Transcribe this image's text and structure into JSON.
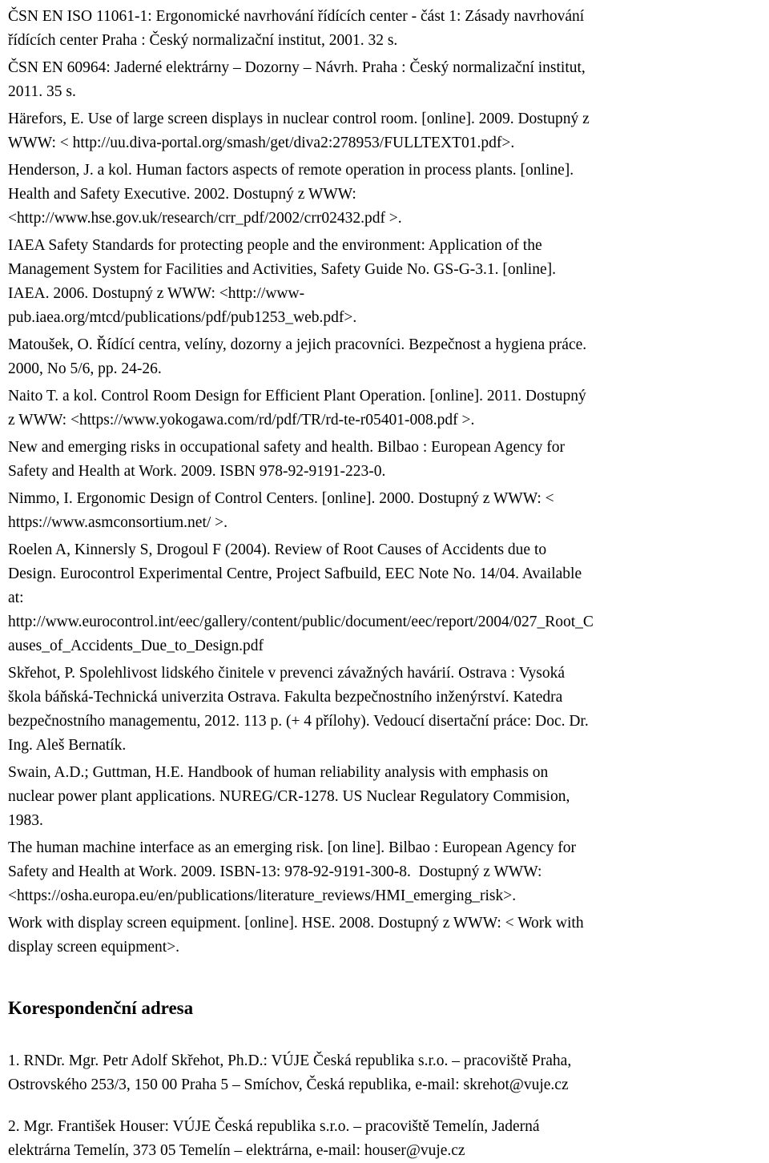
{
  "document": {
    "type": "bibliography-and-contact-page",
    "language": "cs",
    "references": [
      "ČSN EN ISO 11061-1: Ergonomické navrhování řídících center - část 1: Zásady navrhování\nřídících center Praha : Český normalizační institut, 2001. 32 s.",
      "ČSN EN 60964: Jaderné elektrárny – Dozorny – Návrh. Praha : Český normalizační institut,\n2011. 35 s.",
      "Härefors, E. Use of large screen displays in nuclear control room. [online]. 2009. Dostupný z\nWWW: < http://uu.diva-portal.org/smash/get/diva2:278953/FULLTEXT01.pdf>.",
      "Henderson, J. a kol. Human factors aspects of remote operation in process plants. [online].\nHealth and Safety Executive. 2002. Dostupný z WWW:\n<http://www.hse.gov.uk/research/crr_pdf/2002/crr02432.pdf >.",
      "IAEA Safety Standards for protecting people and the environment: Application of the\nManagement System for Facilities and Activities, Safety Guide No. GS-G-3.1. [online].\nIAEA. 2006. Dostupný z WWW: <http://www-\npub.iaea.org/mtcd/publications/pdf/pub1253_web.pdf>.",
      "Matoušek, O. Řídící centra, velíny, dozorny a jejich pracovníci. Bezpečnost a hygiena práce.\n2000, No 5/6, pp. 24-26.",
      "Naito T. a kol. Control Room Design for Efficient Plant Operation. [online]. 2011. Dostupný\nz WWW: <https://www.yokogawa.com/rd/pdf/TR/rd-te-r05401-008.pdf >.",
      "New and emerging risks in occupational safety and health. Bilbao : European Agency for\nSafety and Health at Work. 2009. ISBN 978-92-9191-223-0.",
      "Nimmo, I. Ergonomic Design of Control Centers. [online]. 2000. Dostupný z WWW: <\nhttps://www.asmconsortium.net/ >.",
      "Roelen A, Kinnersly S, Drogoul F (2004). Review of Root Causes of Accidents due to\nDesign. Eurocontrol Experimental Centre, Project Safbuild, EEC Note No. 14/04. Available\nat:\nhttp://www.eurocontrol.int/eec/gallery/content/public/document/eec/report/2004/027_Root_C\nauses_of_Accidents_Due_to_Design.pdf",
      "Skřehot, P. Spolehlivost lidského činitele v prevenci závažných havárií. Ostrava : Vysoká\nškola báňská-Technická univerzita Ostrava. Fakulta bezpečnostního inženýrství. Katedra\nbezpečnostního managementu, 2012. 113 p. (+ 4 přílohy). Vedoucí disertační práce: Doc. Dr.\nIng. Aleš Bernatík.",
      "Swain, A.D.; Guttman, H.E. Handbook of human reliability analysis with emphasis on\nnuclear power plant applications. NUREG/CR-1278. US Nuclear Regulatory Commision,\n1983.",
      "The human machine interface as an emerging risk. [on line]. Bilbao : European Agency for\nSafety and Health at Work. 2009. ISBN-13: 978-92-9191-300-8.  Dostupný z WWW:\n<https://osha.europa.eu/en/publications/literature_reviews/HMI_emerging_risk>.",
      "Work with display screen equipment. [online]. HSE. 2008. Dostupný z WWW: < Work with\ndisplay screen equipment>."
    ],
    "correspondence": {
      "heading": "Korespondenční adresa",
      "entries": [
        "1. RNDr. Mgr. Petr Adolf Skřehot, Ph.D.: VÚJE Česká republika s.r.o. – pracoviště Praha,\nOstrovského 253/3, 150 00 Praha 5 – Smíchov, Česká republika, e-mail: skrehot@vuje.cz",
        "2. Mgr. František Houser: VÚJE Česká republika s.r.o. – pracoviště Temelín, Jaderná\nelektrárna Temelín, 373 05 Temelín – elektrárna, e-mail: houser@vuje.cz"
      ]
    }
  }
}
